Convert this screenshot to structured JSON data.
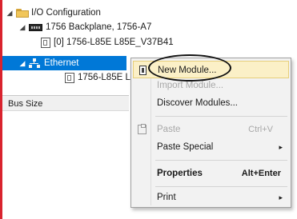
{
  "tree": {
    "io_config": "I/O Configuration",
    "backplane": "1756 Backplane, 1756-A7",
    "controller": "[0] 1756-L85E L85E_V37B41",
    "ethernet": "Ethernet",
    "eth_module": "1756-L85E L"
  },
  "panel": {
    "bus_size_header": "Bus Size"
  },
  "context_menu": {
    "items": [
      {
        "label": "New Module...",
        "shortcut": "",
        "highlighted": true,
        "disabled": false
      },
      {
        "label": "Import Module...",
        "shortcut": "",
        "disabled": true
      },
      {
        "label": "Discover Modules...",
        "shortcut": "",
        "disabled": false
      },
      {
        "label": "Paste",
        "shortcut": "Ctrl+V",
        "disabled": true
      },
      {
        "label": "Paste Special",
        "shortcut": "",
        "has_submenu": true
      },
      {
        "label": "Properties",
        "shortcut": "Alt+Enter",
        "bold": true
      },
      {
        "label": "Print",
        "shortcut": "",
        "has_submenu": true
      }
    ]
  },
  "icons": {
    "expand_arrow": "◢",
    "submenu_arrow": "▸"
  },
  "colors": {
    "selection": "#0078d7",
    "highlight": "#fbf0c7",
    "left_bar": "#d9232e"
  }
}
